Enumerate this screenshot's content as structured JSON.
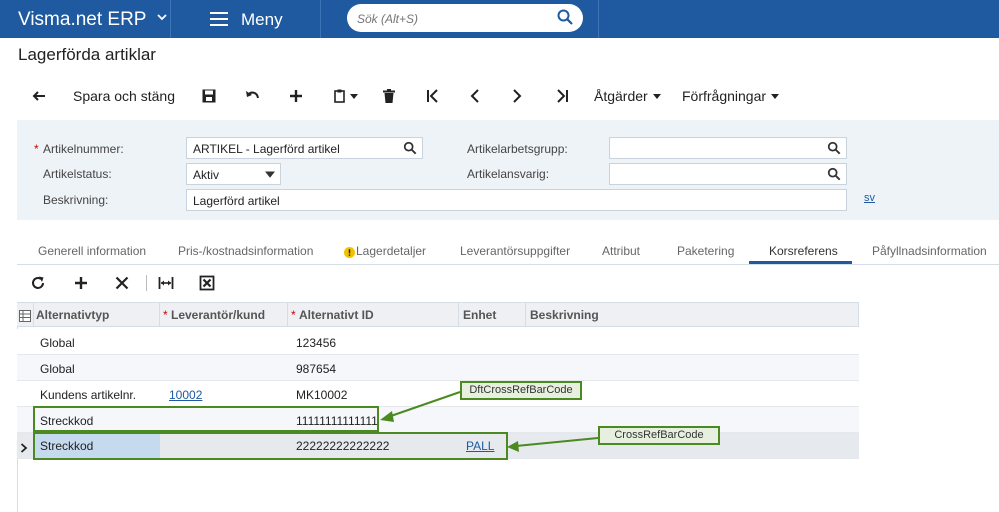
{
  "app": {
    "brand": "Visma.net ERP",
    "menu_label": "Meny",
    "search_placeholder": "Sök (Alt+S)"
  },
  "page": {
    "title": "Lagerförda artiklar"
  },
  "toolbar": {
    "save_close": "Spara och stäng",
    "actions": "Åtgärder",
    "inquiries": "Förfrågningar"
  },
  "form": {
    "item_number_label": "Artikelnummer:",
    "item_number_value": "ARTIKEL - Lagerförd artikel",
    "item_status_label": "Artikelstatus:",
    "item_status_value": "Aktiv",
    "description_label": "Beskrivning:",
    "description_value": "Lagerförd artikel",
    "workgroup_label": "Artikelarbetsgrupp:",
    "workgroup_value": "",
    "responsible_label": "Artikelansvarig:",
    "responsible_value": "",
    "language_link": "sv"
  },
  "tabs": [
    {
      "label": "Generell information"
    },
    {
      "label": "Pris-/kostnadsinformation"
    },
    {
      "label": "Lagerdetaljer"
    },
    {
      "label": "Leverantörsuppgifter"
    },
    {
      "label": "Attribut"
    },
    {
      "label": "Paketering"
    },
    {
      "label": "Korsreferens"
    },
    {
      "label": "Påfyllnadsinformation"
    }
  ],
  "grid": {
    "columns": [
      "Alternativtyp",
      "Leverantör/kund",
      "Alternativt ID",
      "Enhet",
      "Beskrivning"
    ],
    "rows": [
      {
        "type": "Global",
        "vendor": "",
        "alt_id": "123456",
        "unit": "",
        "desc": ""
      },
      {
        "type": "Global",
        "vendor": "",
        "alt_id": "987654",
        "unit": "",
        "desc": ""
      },
      {
        "type": "Kundens artikelnr.",
        "vendor": "10002",
        "alt_id": "MK10002",
        "unit": "",
        "desc": ""
      },
      {
        "type": "Streckkod",
        "vendor": "",
        "alt_id": "11111111111111",
        "unit": "",
        "desc": ""
      },
      {
        "type": "Streckkod",
        "vendor": "",
        "alt_id": "22222222222222",
        "unit": "PALL",
        "desc": ""
      }
    ]
  },
  "annotations": {
    "dft_label": "DftCrossRefBarCode",
    "cross_label": "CrossRefBarCode"
  },
  "colors": {
    "header_bg": "#1f5aa0",
    "accent": "#1f5aa0",
    "annotation_green": "#4a8a21",
    "warning_yellow": "#f2c200"
  }
}
